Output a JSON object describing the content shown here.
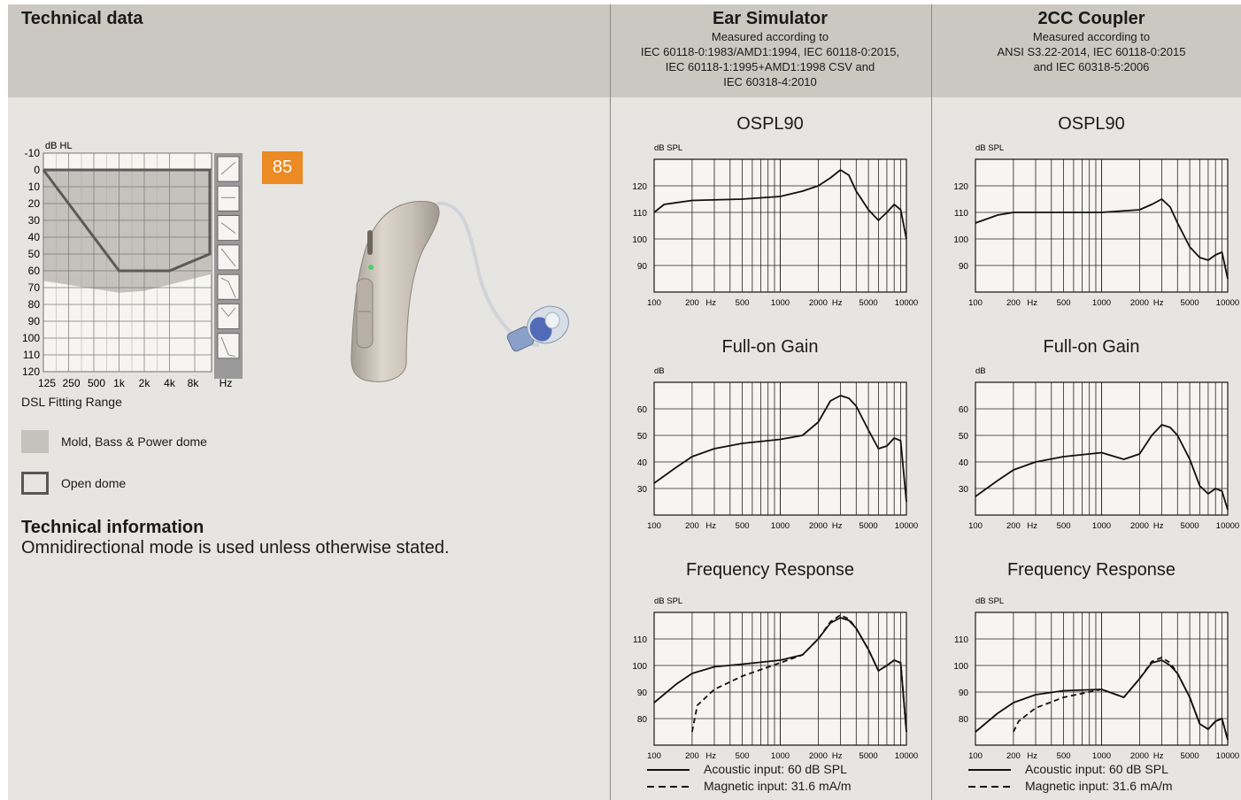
{
  "header": {
    "title": "Technical data",
    "ear_sim": {
      "title": "Ear Simulator",
      "lines": [
        "Measured according to",
        "IEC 60118-0:1983/AMD1:1994, IEC 60118-0:2015,",
        "IEC 60118-1:1995+AMD1:1998 CSV and",
        "IEC 60318-4:2010"
      ]
    },
    "coupler": {
      "title": "2CC Coupler",
      "lines": [
        "Measured according to",
        "ANSI S3.22-2014, IEC 60118-0:2015",
        "and IEC 60318-5:2006"
      ]
    }
  },
  "audiogram": {
    "unit": "dB HL",
    "y_ticks": [
      "-10",
      "0",
      "10",
      "20",
      "30",
      "40",
      "50",
      "60",
      "70",
      "80",
      "90",
      "100",
      "110",
      "120"
    ],
    "x_ticks": [
      "125",
      "250",
      "500",
      "1k",
      "2k",
      "4k",
      "8k",
      "Hz"
    ],
    "caption": "DSL Fitting Range",
    "badge": "85",
    "legend_mold": "Mold, Bass & Power dome",
    "legend_open": "Open dome"
  },
  "tech_info": {
    "heading": "Technical information",
    "text": "Omnidirectional mode is used unless otherwise stated."
  },
  "graph_titles": {
    "ospl": "OSPL90",
    "gain": "Full-on Gain",
    "freq": "Frequency Response"
  },
  "units": {
    "spl": "dB SPL",
    "db": "dB"
  },
  "legend": {
    "acoustic": "Acoustic input: 60 dB SPL",
    "magnetic": "Magnetic input: 31.6 mA/m"
  },
  "chart_data": [
    {
      "type": "line",
      "title": "OSPL90",
      "ylabel": "dB SPL",
      "xscale": "log",
      "xlim": [
        100,
        10000
      ],
      "ylim": [
        80,
        130
      ],
      "x_ticks": [
        "100",
        "200",
        "Hz",
        "500",
        "1000",
        "2000",
        "Hz",
        "5000",
        "10000"
      ],
      "y_ticks": [
        90,
        100,
        110,
        120
      ],
      "series": [
        {
          "x": [
            100,
            120,
            200,
            500,
            1000,
            1500,
            2000,
            2500,
            3000,
            3500,
            4000,
            5000,
            6000,
            7000,
            8000,
            9000,
            10000
          ],
          "y": [
            110,
            113,
            114.5,
            115,
            116,
            118,
            120,
            123,
            126,
            124,
            118,
            111,
            107,
            110,
            113,
            111,
            100
          ]
        }
      ]
    },
    {
      "type": "line",
      "title": "OSPL90",
      "ylabel": "dB SPL",
      "xscale": "log",
      "xlim": [
        100,
        10000
      ],
      "ylim": [
        80,
        130
      ],
      "x_ticks": [
        "100",
        "200",
        "Hz",
        "500",
        "1000",
        "2000",
        "Hz",
        "5000",
        "10000"
      ],
      "y_ticks": [
        90,
        100,
        110,
        120
      ],
      "series": [
        {
          "x": [
            100,
            150,
            200,
            500,
            1000,
            2000,
            2500,
            3000,
            3500,
            4000,
            5000,
            6000,
            7000,
            8000,
            9000,
            10000
          ],
          "y": [
            106,
            109,
            110,
            110,
            110,
            111,
            113,
            115,
            112,
            106,
            97,
            93,
            92,
            94,
            95,
            85
          ]
        }
      ]
    },
    {
      "type": "line",
      "title": "Full-on Gain",
      "ylabel": "dB",
      "xscale": "log",
      "xlim": [
        100,
        10000
      ],
      "ylim": [
        20,
        70
      ],
      "x_ticks": [
        "100",
        "200",
        "Hz",
        "500",
        "1000",
        "2000",
        "Hz",
        "5000",
        "10000"
      ],
      "y_ticks": [
        30,
        40,
        50,
        60
      ],
      "series": [
        {
          "x": [
            100,
            150,
            200,
            300,
            500,
            1000,
            1500,
            2000,
            2500,
            3000,
            3500,
            4000,
            5000,
            6000,
            7000,
            8000,
            9000,
            10000
          ],
          "y": [
            32,
            38,
            42,
            45,
            47,
            48.5,
            50,
            55,
            63,
            65,
            64,
            61,
            52,
            45,
            46,
            49,
            48,
            25
          ]
        }
      ]
    },
    {
      "type": "line",
      "title": "Full-on Gain",
      "ylabel": "dB",
      "xscale": "log",
      "xlim": [
        100,
        10000
      ],
      "ylim": [
        20,
        70
      ],
      "x_ticks": [
        "100",
        "200",
        "Hz",
        "500",
        "1000",
        "2000",
        "Hz",
        "5000",
        "10000"
      ],
      "y_ticks": [
        30,
        40,
        50,
        60
      ],
      "series": [
        {
          "x": [
            100,
            150,
            200,
            300,
            500,
            1000,
            1500,
            2000,
            2500,
            3000,
            3500,
            4000,
            5000,
            6000,
            7000,
            8000,
            9000,
            10000
          ],
          "y": [
            27,
            33,
            37,
            40,
            42,
            43.5,
            41,
            43,
            50,
            54,
            53,
            50,
            41,
            31,
            28,
            30,
            29,
            22
          ]
        }
      ]
    },
    {
      "type": "line",
      "title": "Frequency Response",
      "ylabel": "dB SPL",
      "xscale": "log",
      "xlim": [
        100,
        10000
      ],
      "ylim": [
        70,
        120
      ],
      "x_ticks": [
        "100",
        "200",
        "Hz",
        "500",
        "1000",
        "2000",
        "Hz",
        "5000",
        "10000"
      ],
      "y_ticks": [
        80,
        90,
        100,
        110
      ],
      "series": [
        {
          "name": "Acoustic input: 60 dB SPL",
          "x": [
            100,
            150,
            200,
            300,
            500,
            1000,
            1500,
            2000,
            2500,
            3000,
            3500,
            4000,
            5000,
            6000,
            7000,
            8000,
            9000,
            10000
          ],
          "y": [
            86,
            93,
            97,
            99.5,
            100.5,
            102,
            104,
            110,
            116,
            118,
            117,
            114,
            106,
            98,
            100,
            102,
            101,
            75
          ]
        },
        {
          "name": "Magnetic input: 31.6 mA/m",
          "x": [
            200,
            220,
            300,
            500,
            1000,
            1500,
            2000,
            2500,
            3000,
            3500,
            4000,
            5000,
            6000,
            7000,
            8000,
            9000,
            10000
          ],
          "y": [
            75,
            85,
            91,
            96,
            101,
            104,
            110,
            116.5,
            119,
            117.5,
            114,
            106,
            98,
            100,
            102,
            101,
            75
          ]
        }
      ]
    },
    {
      "type": "line",
      "title": "Frequency Response",
      "ylabel": "dB SPL",
      "xscale": "log",
      "xlim": [
        100,
        10000
      ],
      "ylim": [
        70,
        120
      ],
      "x_ticks": [
        "100",
        "200",
        "Hz",
        "500",
        "1000",
        "2000",
        "Hz",
        "5000",
        "10000"
      ],
      "y_ticks": [
        80,
        90,
        100,
        110
      ],
      "series": [
        {
          "name": "Acoustic input: 60 dB SPL",
          "x": [
            100,
            150,
            200,
            300,
            500,
            1000,
            1500,
            2000,
            2500,
            3000,
            3500,
            4000,
            5000,
            6000,
            7000,
            8000,
            9000,
            10000
          ],
          "y": [
            75,
            82,
            86,
            89,
            90.5,
            91,
            88,
            95,
            101,
            102,
            100,
            97,
            88,
            78,
            76,
            79,
            80,
            72
          ]
        },
        {
          "name": "Magnetic input: 31.6 mA/m",
          "x": [
            200,
            220,
            300,
            500,
            1000,
            1500,
            2000,
            2500,
            3000,
            3500,
            4000,
            5000,
            6000,
            7000,
            8000,
            9000,
            10000
          ],
          "y": [
            75,
            79,
            84,
            88,
            91,
            88,
            95,
            101.5,
            103,
            101,
            97,
            88,
            78,
            76,
            79,
            80,
            72
          ]
        }
      ]
    }
  ]
}
